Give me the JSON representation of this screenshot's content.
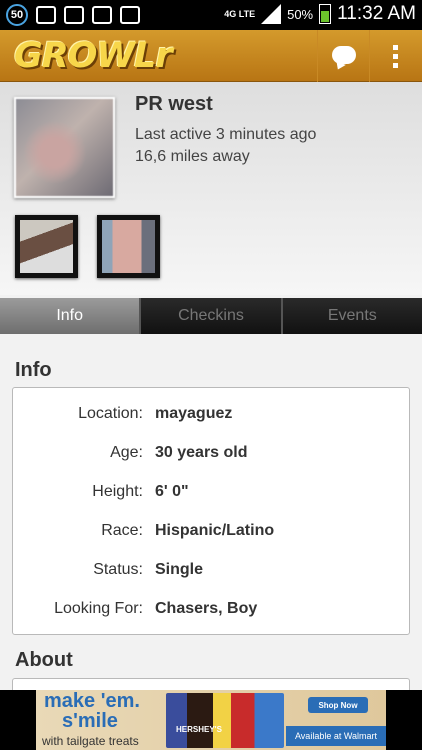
{
  "status_bar": {
    "notification_count": "50",
    "network": "4G LTE",
    "battery": "50%",
    "time": "11:32 AM"
  },
  "app_bar": {
    "logo_text": "GROWLr"
  },
  "profile": {
    "name": "PR west",
    "last_active": "Last active 3 minutes ago",
    "distance": "16,6 miles away"
  },
  "tabs": [
    {
      "label": "Info",
      "active": true
    },
    {
      "label": "Checkins",
      "active": false
    },
    {
      "label": "Events",
      "active": false
    }
  ],
  "info": {
    "title": "Info",
    "rows": [
      {
        "label": "Location:",
        "value": "mayaguez"
      },
      {
        "label": "Age:",
        "value": "30 years old"
      },
      {
        "label": "Height:",
        "value": "6' 0\""
      },
      {
        "label": "Race:",
        "value": "Hispanic/Latino"
      },
      {
        "label": "Status:",
        "value": "Single"
      },
      {
        "label": "Looking For:",
        "value": "Chasers, Boy"
      }
    ]
  },
  "about": {
    "title": "About"
  },
  "ad": {
    "line1": "make 'em.",
    "line2": "s'mile",
    "line3": "with tailgate treats",
    "product": "HERSHEY'S",
    "shop": "Shop Now",
    "cta": "Available at Walmart"
  },
  "colors": {
    "appbar": "#c98a25",
    "logo": "#f7d64a",
    "active_tab": "#8a8a8a",
    "battery": "#6cc22b"
  }
}
